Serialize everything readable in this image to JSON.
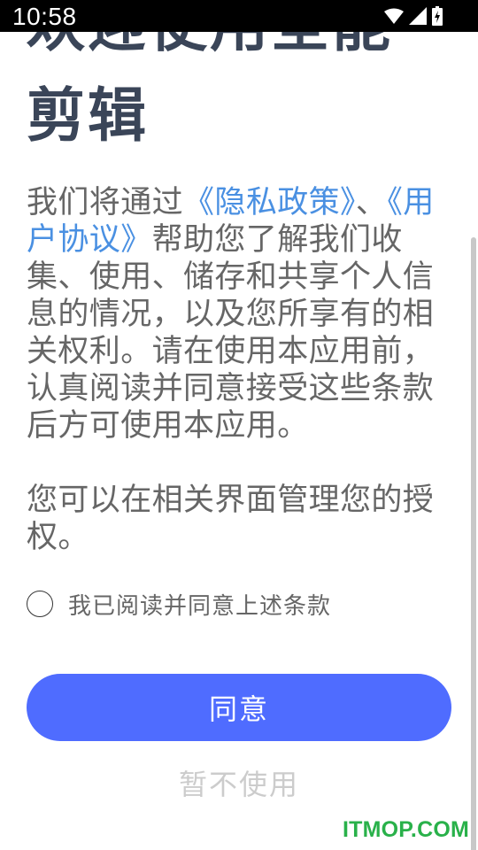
{
  "status_bar": {
    "time": "10:58",
    "icons": [
      "wifi-icon",
      "signal-icon",
      "battery-icon"
    ]
  },
  "title": "欢迎使用全能剪辑",
  "policy": {
    "part1": "我们将通过",
    "privacy_link": "《隐私政策》",
    "separator": "、",
    "user_agreement_link": "《用户协议》",
    "part2": "帮助您了解我们收集、使用、储存和共享个人信息的情况，以及您所享有的相关权利。请在使用本应用前，认真阅读并同意接受这些条款后方可使用本应用。"
  },
  "manage_text": "您可以在相关界面管理您的授权。",
  "agree_checkbox_label": "我已阅读并同意上述条款",
  "agree_button": "同意",
  "decline_button": "暂不使用",
  "watermark": "ITMOP.COM",
  "colors": {
    "accent_button": "#4f6cff",
    "link": "#4a90e2",
    "title": "#3a4558",
    "body_text": "#666666",
    "watermark": "#29b14a"
  }
}
